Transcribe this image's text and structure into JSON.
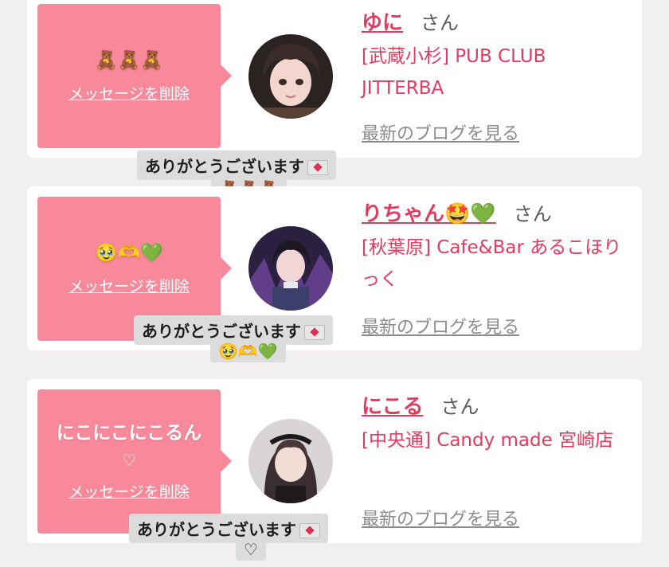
{
  "cards": [
    {
      "bubble_message": "🧸🧸🧸",
      "bubble_sub": "",
      "delete_label": "メッセージを削除",
      "name": "ゆに",
      "honorific": "さん",
      "shop": "[武蔵小杉] PUB CLUB JITTERBA",
      "blog_link": "最新のブログを見る",
      "reply_text": "ありがとうございます",
      "reply_sub": "🧸🧸🧸"
    },
    {
      "bubble_message": "🥹🫶💚",
      "bubble_sub": "",
      "delete_label": "メッセージを削除",
      "name": "りちゃん🤩💚",
      "honorific": "さん",
      "shop": "[秋葉原] Cafe&Bar あるこほりっく",
      "blog_link": "最新のブログを見る",
      "reply_text": "ありがとうございます",
      "reply_sub": "🥹🫶💚"
    },
    {
      "bubble_message": "にこにこにこるん",
      "bubble_sub": "♡",
      "delete_label": "メッセージを削除",
      "name": "にこる",
      "honorific": "さん",
      "shop": "[中央通] Candy made 宮崎店",
      "blog_link": "最新のブログを見る",
      "reply_text": "ありがとうございます",
      "reply_sub": "♡"
    }
  ],
  "colors": {
    "bubble": "#f8899b",
    "accent": "#e33a5f",
    "link_gray": "#8c8c8c",
    "reply_bg": "#dcdcdc"
  },
  "icons": {
    "reply_badge": "envelope-heart-icon"
  }
}
